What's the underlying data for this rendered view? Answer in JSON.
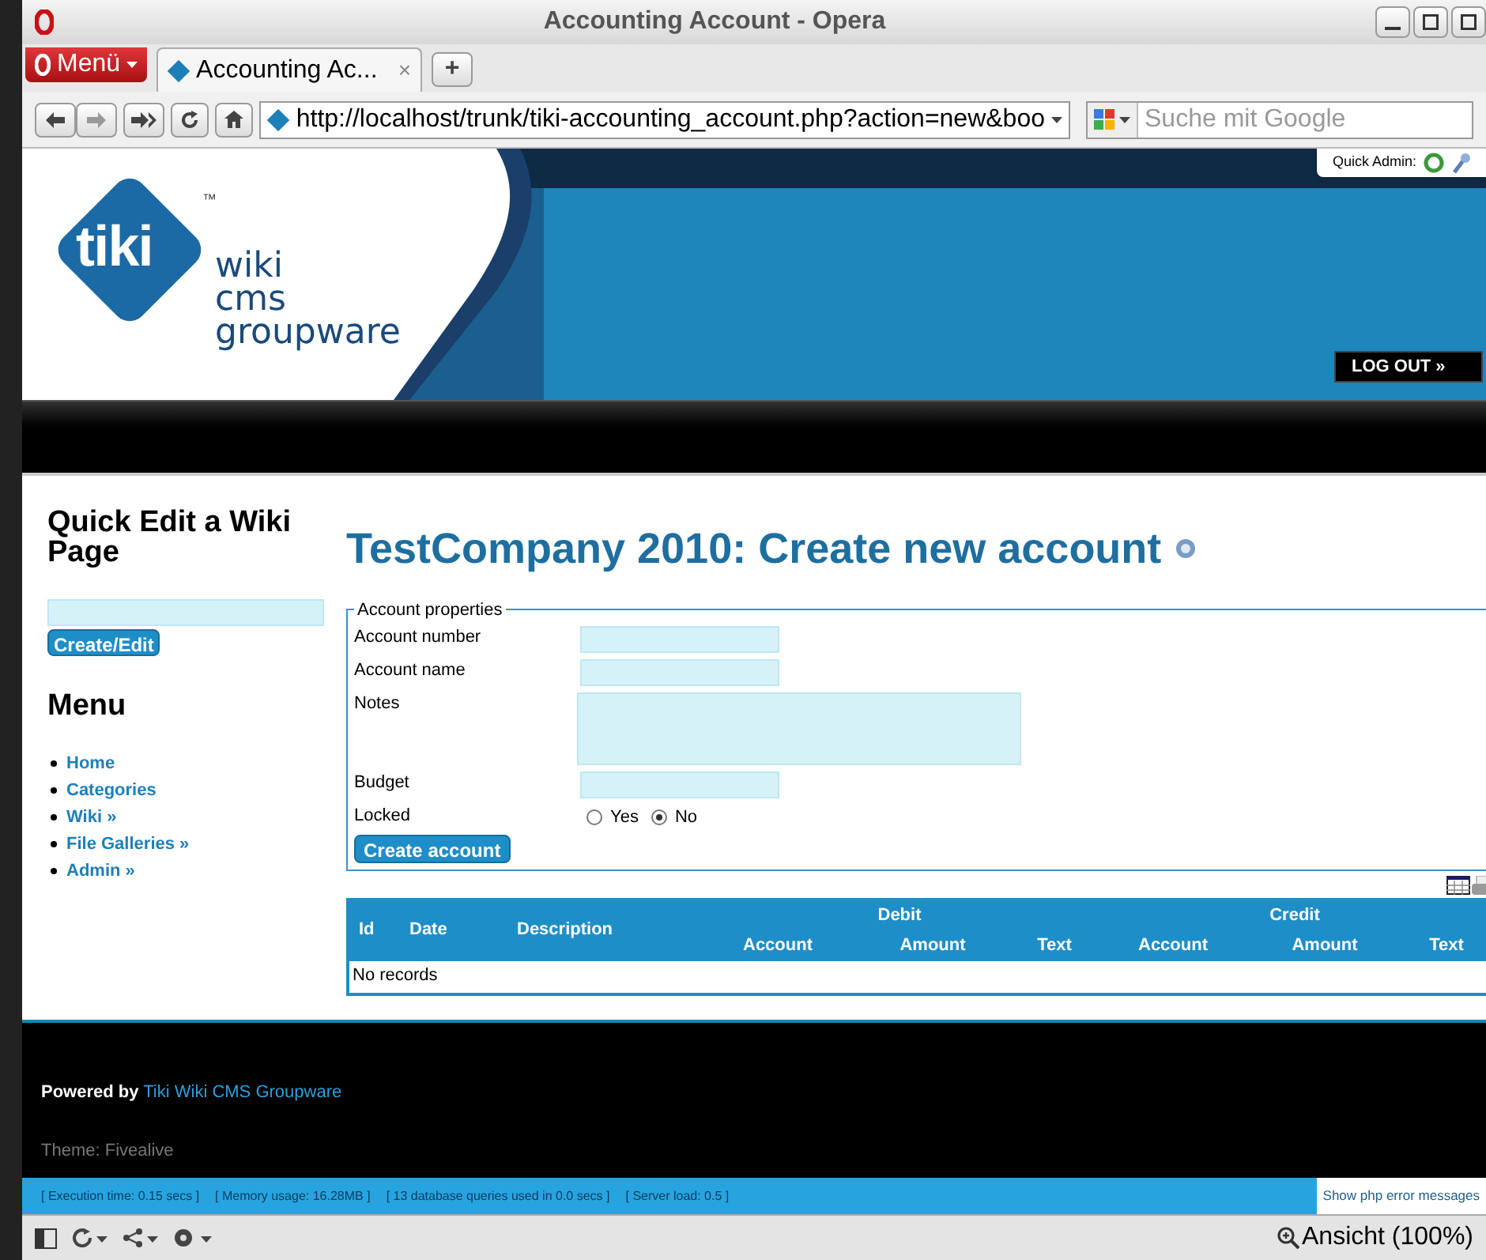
{
  "window": {
    "title": "Accounting Account - Opera"
  },
  "browser": {
    "menu_label": "Menü",
    "tabs": [
      {
        "label": "Accounting Ac...",
        "close": "×",
        "selected": true
      }
    ],
    "new_tab": "+",
    "url": "http://localhost/trunk/tiki-accounting_account.php?action=new&boo",
    "search_placeholder": "Suche mit Google",
    "zoom_label": "Ansicht (100%)"
  },
  "quick_admin": {
    "label": "Quick Admin:"
  },
  "logo": {
    "mark": "tiki",
    "tm": "™",
    "lines": [
      "wiki",
      "cms",
      "groupware"
    ]
  },
  "logout": "LOG OUT »",
  "sidebar": {
    "quick_edit_title": "Quick Edit a Wiki Page",
    "quick_edit_button": "Create/Edit",
    "menu_title": "Menu",
    "items": [
      {
        "label": "Home"
      },
      {
        "label": "Categories"
      },
      {
        "label": "Wiki »"
      },
      {
        "label": "File Galleries »"
      },
      {
        "label": "Admin »"
      }
    ]
  },
  "page": {
    "title": "TestCompany 2010: Create new account"
  },
  "form": {
    "legend": "Account properties",
    "fields": [
      {
        "label": "Account number",
        "kind": "input"
      },
      {
        "label": "Account name",
        "kind": "input"
      },
      {
        "label": "Notes",
        "kind": "textarea"
      },
      {
        "label": "Budget",
        "kind": "input"
      },
      {
        "label": "Locked",
        "kind": "radio",
        "options": [
          {
            "label": "Yes",
            "selected": false
          },
          {
            "label": "No",
            "selected": true
          }
        ]
      }
    ],
    "submit": "Create account"
  },
  "table": {
    "columns": [
      "Id",
      "Date",
      "Description"
    ],
    "groups": [
      {
        "label": "Debit",
        "columns": [
          "Account",
          "Amount",
          "Text"
        ]
      },
      {
        "label": "Credit",
        "columns": [
          "Account",
          "Amount",
          "Text"
        ]
      }
    ],
    "empty": "No records"
  },
  "footer": {
    "powered_by": "Powered by",
    "link": "Tiki Wiki CMS Groupware",
    "theme": "Theme: Fivealive",
    "stats": [
      "[ Execution time: 0.15 secs ]",
      "[ Memory usage: 16.28MB ]",
      "[ 13 database queries used in 0.0 secs ]",
      "[ Server load: 0.5 ]"
    ],
    "php_errors": "Show php error messages"
  }
}
